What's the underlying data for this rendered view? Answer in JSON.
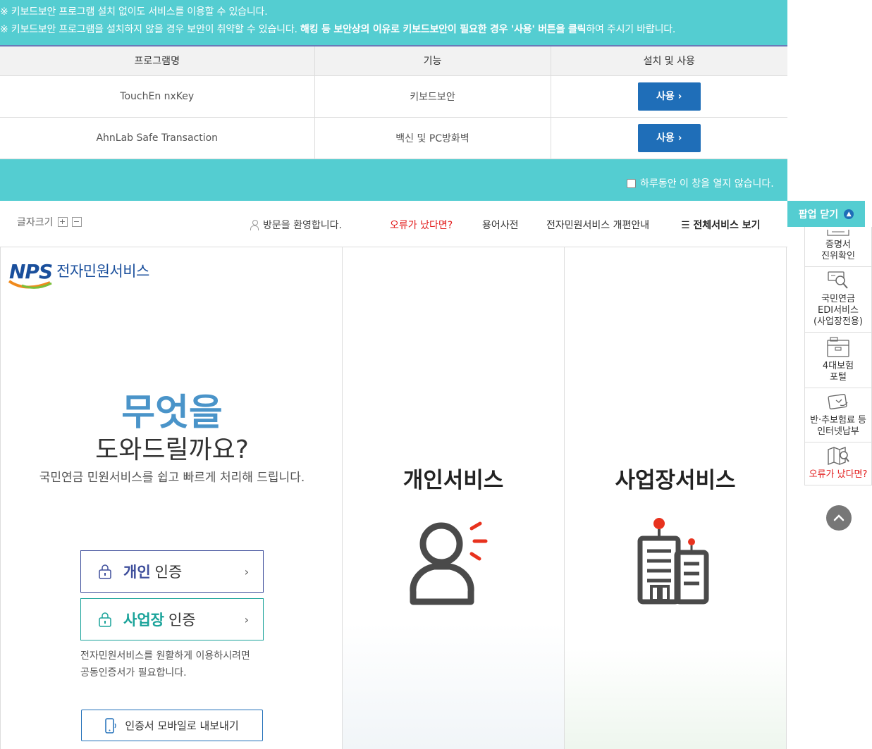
{
  "popup": {
    "notice_line1": "※ 키보드보안 프로그램 설치 없이도 서비스를 이용할 수 있습니다.",
    "notice_line2_normal": "※ 키보드보안 프로그램을 설치하지 않을 경우 보안이 취약할 수 있습니다.",
    "notice_line2_bold": "해킹 등 보안상의 이유로 키보드보안이 필요한 경우 '사용' 버튼을 클릭",
    "notice_line2_tail": "하여 주시기 바랍니다.",
    "table": {
      "headers": [
        "프로그램명",
        "기능",
        "설치 및 사용"
      ],
      "rows": [
        {
          "program": "TouchEn nxKey",
          "function": "키보드보안",
          "button": "사용 ›"
        },
        {
          "program": "AhnLab Safe Transaction",
          "function": "백신 및 PC방화벽",
          "button": "사용 ›"
        }
      ]
    },
    "dont_open_label": "하루동안 이 창을 열지 않습니다.",
    "close_label": "팝업 닫기"
  },
  "topbar": {
    "fontsize_label": "글자크기",
    "plus": "+",
    "minus": "−",
    "welcome": "방문을 환영합니다.",
    "error_link": "오류가 났다면?",
    "dictionary": "용어사전",
    "renewal_guide": "전자민원서비스 개편안내",
    "all_services": "☰ 전체서비스 보기"
  },
  "logo": {
    "brand": "NPS",
    "title": "전자민원서비스"
  },
  "hero": {
    "big": "무엇을",
    "mid": "도와드릴까요?",
    "sub": "국민연금 민원서비스를 쉽고 빠르게 처리해 드립니다."
  },
  "auth": {
    "personal_strong": "개인",
    "personal_plain": "인증",
    "business_strong": "사업장",
    "business_plain": "인증",
    "arrow": "›",
    "note_line1": "전자민원서비스를 원활하게 이용하시려면",
    "note_line2": "공동인증서가 필요합니다.",
    "mobile_export": "인증서 모바일로 내보내기"
  },
  "services": {
    "personal": "개인서비스",
    "business": "사업장서비스"
  },
  "quick_menu": [
    {
      "icon": "certificate-verify-icon",
      "line1": "증명서",
      "line2": "진위확인",
      "line3": ""
    },
    {
      "icon": "edi-search-icon",
      "line1": "국민연금",
      "line2": "EDI서비스",
      "line3": "(사업장전용)"
    },
    {
      "icon": "insurance-portal-icon",
      "line1": "4대보험",
      "line2": "포털",
      "line3": ""
    },
    {
      "icon": "payment-card-icon",
      "line1": "반·추보험료 등",
      "line2": "인터넷납부",
      "line3": ""
    },
    {
      "icon": "map-search-icon",
      "line1": "오류가 났다면?",
      "line2": "",
      "line3": ""
    }
  ],
  "colors": {
    "popup_bg": "#54cdd1",
    "primary_blue": "#1f6eb8",
    "personal_accent": "#3f4f9c",
    "business_accent": "#1aa39a",
    "hero_blue": "#4a94c9",
    "error_red": "#e21b1b"
  }
}
